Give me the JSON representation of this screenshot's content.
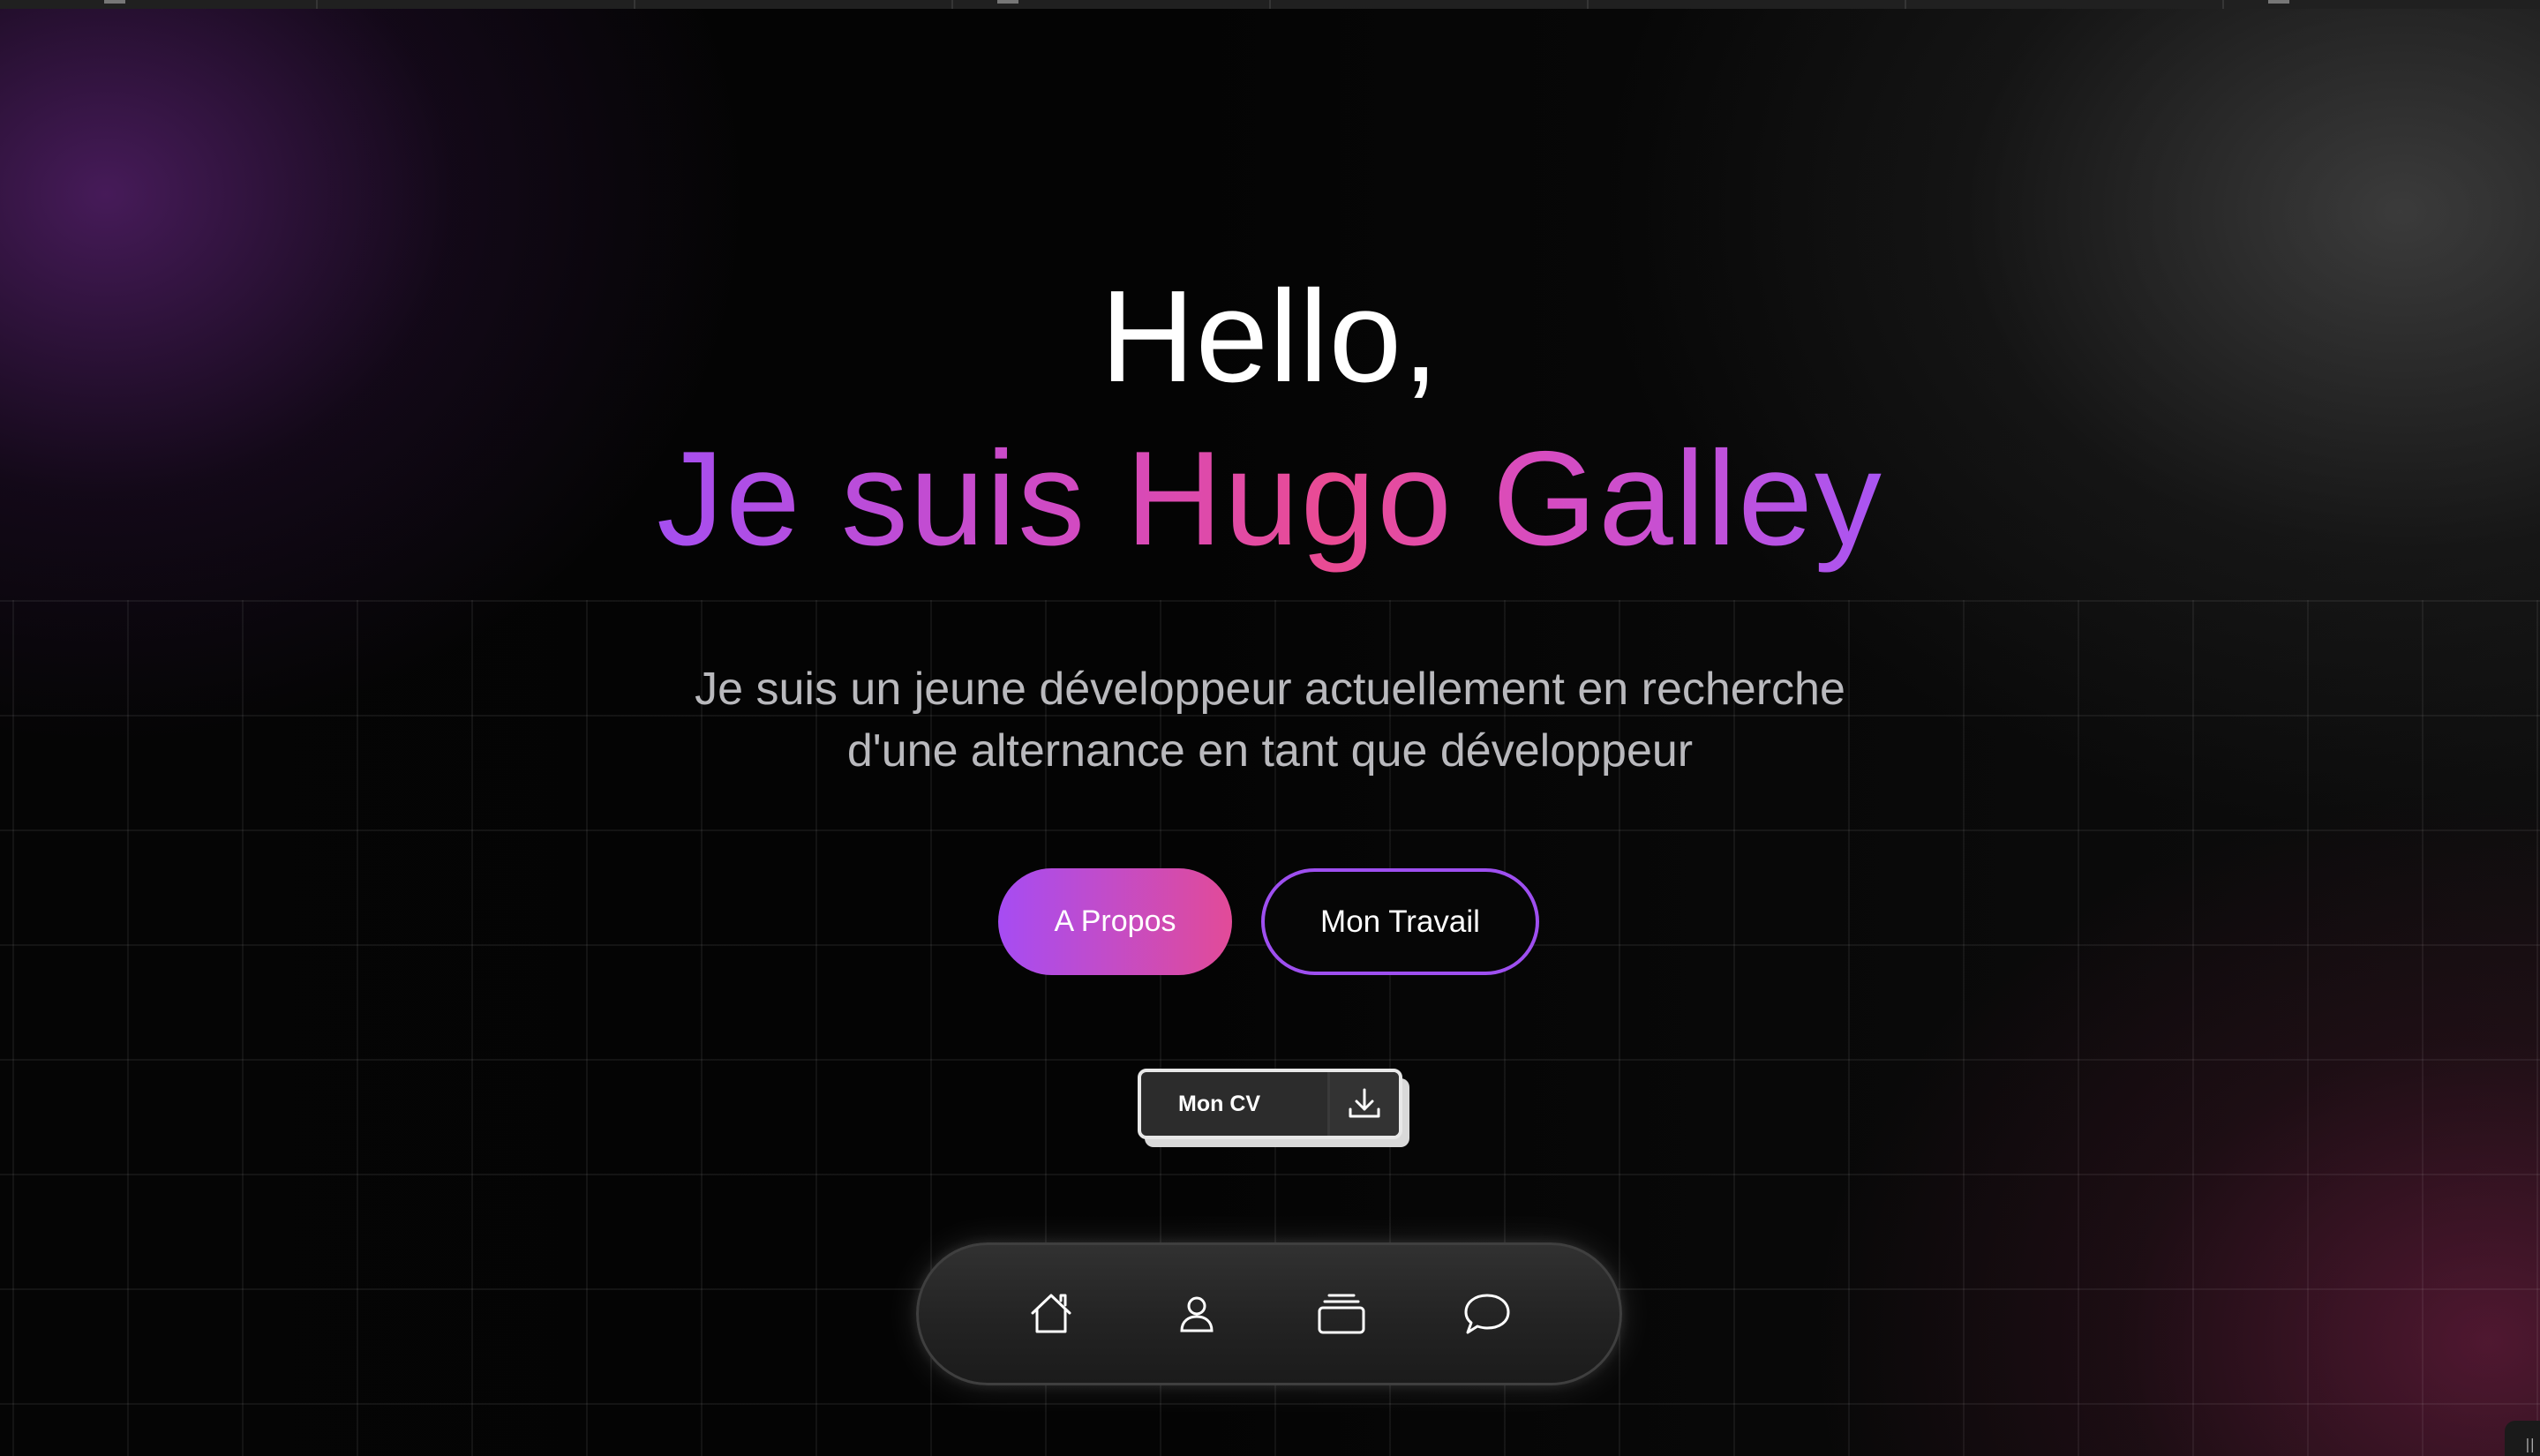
{
  "hero": {
    "greeting": "Hello,",
    "name_line": "Je suis Hugo Galley",
    "description_lines": [
      "Je suis un jeune développeur actuellement en recherche",
      "d'une alternance en tant que développeur"
    ]
  },
  "actions": {
    "about_label": "A Propos",
    "work_label": "Mon Travail",
    "cv_label": "Mon CV",
    "cv_icon": "download-icon"
  },
  "dock": {
    "items": [
      {
        "icon": "home-icon"
      },
      {
        "icon": "user-icon"
      },
      {
        "icon": "stack-icon"
      },
      {
        "icon": "chat-bubble-icon"
      }
    ]
  },
  "colors": {
    "gradient_start": "#a64cf3",
    "gradient_end": "#e24b98",
    "outline_purple": "#9e4ff0",
    "background": "#000000"
  }
}
